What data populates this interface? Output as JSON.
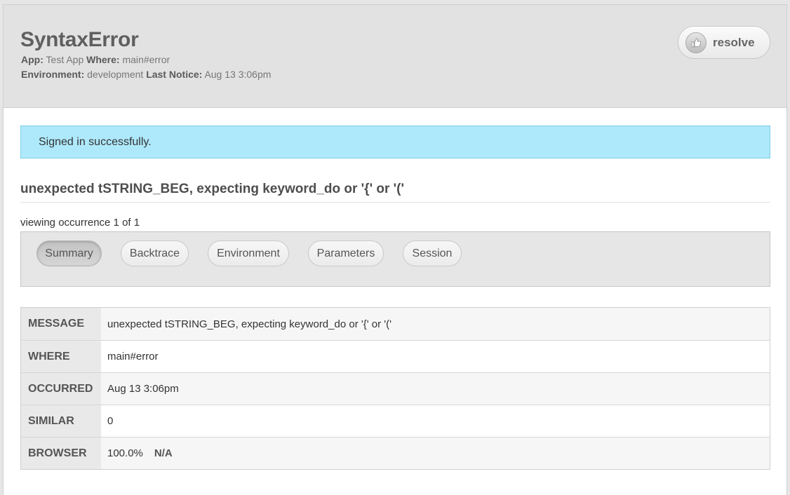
{
  "header": {
    "title": "SyntaxError",
    "app_label": "App:",
    "app_value": "Test App",
    "where_label": "Where:",
    "where_value": "main#error",
    "env_label": "Environment:",
    "env_value": "development",
    "last_notice_label": "Last Notice:",
    "last_notice_value": "Aug 13 3:06pm",
    "resolve_label": "resolve",
    "resolve_icon": "thumbs-up-icon"
  },
  "flash": {
    "message": "Signed in successfully."
  },
  "error": {
    "message": "unexpected tSTRING_BEG, expecting keyword_do or '{' or '('",
    "occurrence": "viewing occurrence 1 of 1"
  },
  "tabs": [
    {
      "label": "Summary",
      "active": true
    },
    {
      "label": "Backtrace",
      "active": false
    },
    {
      "label": "Environment",
      "active": false
    },
    {
      "label": "Parameters",
      "active": false
    },
    {
      "label": "Session",
      "active": false
    }
  ],
  "details": {
    "message": {
      "label": "MESSAGE",
      "value": "unexpected tSTRING_BEG, expecting keyword_do or '{' or '('"
    },
    "where": {
      "label": "WHERE",
      "value": "main#error"
    },
    "occurred": {
      "label": "OCCURRED",
      "value": "Aug 13 3:06pm"
    },
    "similar": {
      "label": "SIMILAR",
      "value": "0"
    },
    "browser": {
      "label": "BROWSER",
      "percent": "100.0%",
      "name": "N/A"
    }
  },
  "colors": {
    "flash_background": "#aee9fb",
    "header_background": "#e2e2e2"
  }
}
